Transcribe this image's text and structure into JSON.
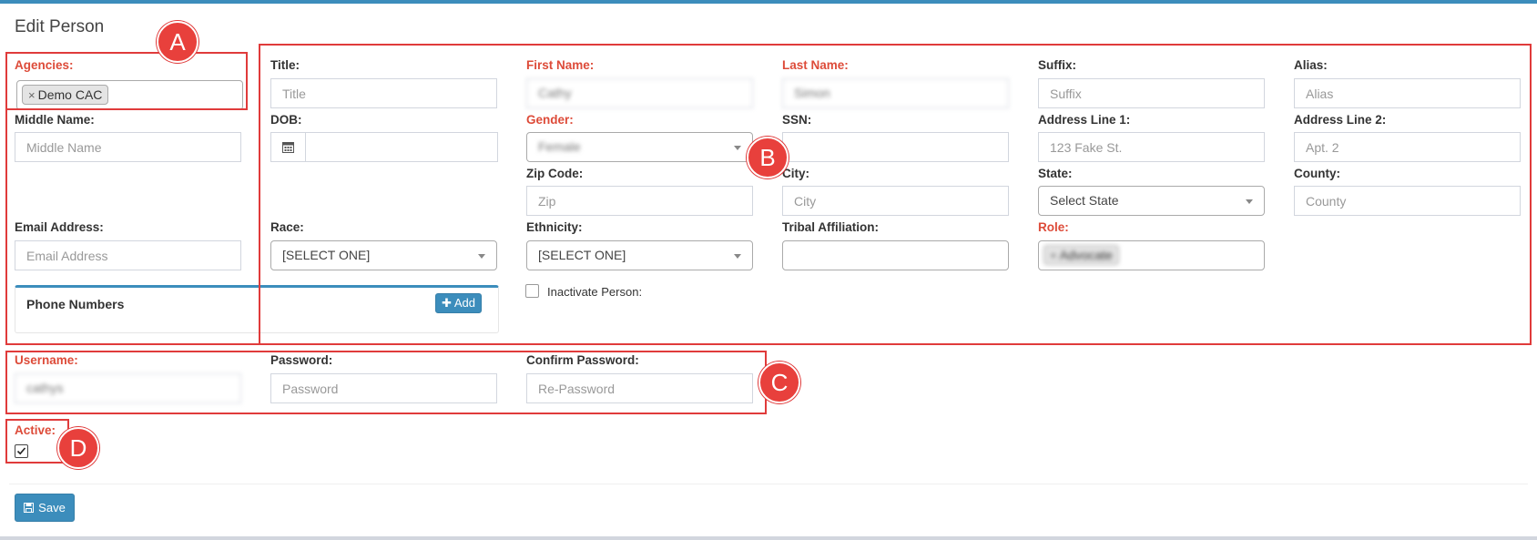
{
  "page": {
    "title": "Edit Person"
  },
  "fields": {
    "agencies": {
      "label": "Agencies:",
      "tag": "Demo CAC"
    },
    "title": {
      "label": "Title:",
      "placeholder": "Title"
    },
    "first_name": {
      "label": "First Name:",
      "value": "Cathy"
    },
    "last_name": {
      "label": "Last Name:",
      "value": "Simon"
    },
    "suffix": {
      "label": "Suffix:",
      "placeholder": "Suffix"
    },
    "alias": {
      "label": "Alias:",
      "placeholder": "Alias"
    },
    "middle_name": {
      "label": "Middle Name:",
      "placeholder": "Middle Name"
    },
    "dob": {
      "label": "DOB:"
    },
    "gender": {
      "label": "Gender:",
      "value": "Female"
    },
    "ssn": {
      "label": "SSN:"
    },
    "address1": {
      "label": "Address Line 1:",
      "placeholder": "123 Fake St."
    },
    "address2": {
      "label": "Address Line 2:",
      "placeholder": "Apt. 2"
    },
    "zip": {
      "label": "Zip Code:",
      "placeholder": "Zip"
    },
    "city": {
      "label": "City:",
      "placeholder": "City"
    },
    "state": {
      "label": "State:",
      "value": "Select State"
    },
    "county": {
      "label": "County:",
      "placeholder": "County"
    },
    "email": {
      "label": "Email Address:",
      "placeholder": "Email Address"
    },
    "race": {
      "label": "Race:",
      "value": "[SELECT ONE]"
    },
    "ethnicity": {
      "label": "Ethnicity:",
      "value": "[SELECT ONE]"
    },
    "tribal": {
      "label": "Tribal Affiliation:"
    },
    "role": {
      "label": "Role:",
      "tag": "Advocate"
    },
    "username": {
      "label": "Username:",
      "value": "cathys"
    },
    "password": {
      "label": "Password:",
      "placeholder": "Password"
    },
    "confirm_password": {
      "label": "Confirm Password:",
      "placeholder": "Re-Password"
    },
    "active": {
      "label": "Active:",
      "checked": true
    }
  },
  "phone_numbers": {
    "title": "Phone Numbers",
    "add_label": "Add"
  },
  "inactivate": {
    "label": "Inactivate Person:"
  },
  "actions": {
    "save_label": "Save"
  },
  "annotations": {
    "a": "A",
    "b": "B",
    "c": "C",
    "d": "D",
    "color": "#e03b3b"
  },
  "colors": {
    "primary": "#3c8dbc",
    "required": "#dd4b39"
  }
}
